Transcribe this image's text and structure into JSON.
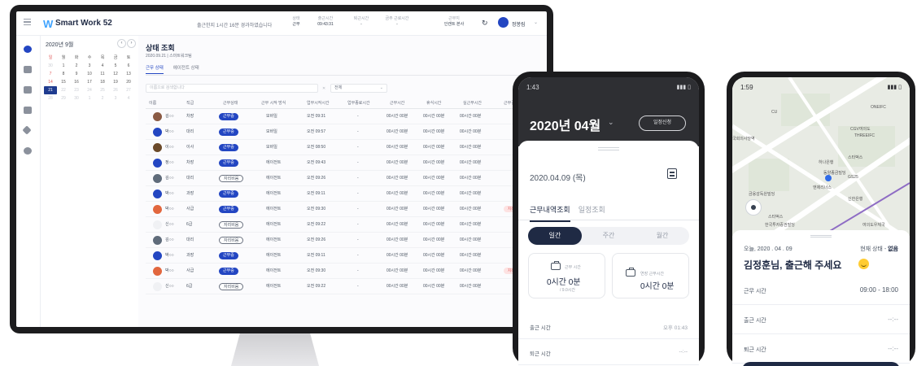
{
  "monitor": {
    "app_name": "Smart Work 52",
    "work_time_msg": "출근한지 1시간 16분 경과하였습니다",
    "header_stats": [
      {
        "label": "상태",
        "value": "근무"
      },
      {
        "label": "출근시간",
        "value": "09:43:31"
      },
      {
        "label": "퇴근시간",
        "value": "-"
      },
      {
        "label": "금주 근로시간",
        "value": "-"
      },
      {
        "label": "근무지",
        "value": "인캔트 본사"
      }
    ],
    "user_name": "정봉림",
    "calendar": {
      "title": "2020년 9월",
      "weekdays": [
        "일",
        "월",
        "화",
        "수",
        "목",
        "금",
        "토"
      ],
      "weeks": [
        [
          "30",
          "1",
          "2",
          "3",
          "4",
          "5",
          "6"
        ],
        [
          "7",
          "8",
          "9",
          "10",
          "11",
          "12",
          "13"
        ],
        [
          "14",
          "15",
          "16",
          "17",
          "18",
          "19",
          "20"
        ],
        [
          "21",
          "22",
          "23",
          "24",
          "25",
          "26",
          "27"
        ],
        [
          "28",
          "29",
          "30",
          "1",
          "2",
          "3",
          "4"
        ]
      ],
      "selected": "21"
    },
    "page_title": "상태 조회",
    "page_sub": "2020.09.21 | 스마트워크팀",
    "tabs": [
      "근무 상태",
      "에이전트 상태"
    ],
    "search_placeholder": "이름으로 검색합니다",
    "filter_value": "전체",
    "columns": [
      "이름",
      "직급",
      "근무상태",
      "근무 시작 방식",
      "업무시작시간",
      "업무종료시간",
      "근무시간",
      "휴식시간",
      "실근무시간",
      "근무결과"
    ],
    "rows": [
      {
        "name": "김○○",
        "rank": "차장",
        "status": "근무중",
        "method": "모바일",
        "start": "오전 09:31",
        "end": "-",
        "work": "00시간 00분",
        "rest": "00시간 00분",
        "real": "00시간 00분",
        "result": ""
      },
      {
        "name": "박○○",
        "rank": "대리",
        "status": "근무중",
        "method": "모바일",
        "start": "오전 09:57",
        "end": "-",
        "work": "00시간 00분",
        "rest": "00시간 00분",
        "real": "00시간 00분",
        "result": ""
      },
      {
        "name": "이○○",
        "rank": "이사",
        "status": "근무중",
        "method": "모바일",
        "start": "오전 08:50",
        "end": "-",
        "work": "00시간 00분",
        "rest": "00시간 00분",
        "real": "00시간 00분",
        "result": ""
      },
      {
        "name": "정○○",
        "rank": "차장",
        "status": "근무중",
        "method": "에이전트",
        "start": "오전 09:43",
        "end": "-",
        "work": "00시간 00분",
        "rest": "00시간 00분",
        "real": "00시간 00분",
        "result": ""
      },
      {
        "name": "김○○",
        "rank": "대리",
        "status": "자리비움",
        "method": "에이전트",
        "start": "오전 09:26",
        "end": "-",
        "work": "00시간 00분",
        "rest": "00시간 00분",
        "real": "00시간 00분",
        "result": ""
      },
      {
        "name": "박○○",
        "rank": "과장",
        "status": "근무중",
        "method": "에이전트",
        "start": "오전 09:11",
        "end": "-",
        "work": "00시간 00분",
        "rest": "00시간 00분",
        "real": "00시간 00분",
        "result": ""
      },
      {
        "name": "박○○",
        "rank": "사급",
        "status": "근무중",
        "method": "에이전트",
        "start": "오전 09:30",
        "end": "-",
        "work": "00시간 00분",
        "rest": "00시간 00분",
        "real": "00시간 00분",
        "result": "지각"
      },
      {
        "name": "신○○",
        "rank": "6급",
        "status": "자리비움",
        "method": "에이전트",
        "start": "오전 09:22",
        "end": "-",
        "work": "00시간 00분",
        "rest": "00시간 00분",
        "real": "00시간 00분",
        "result": ""
      },
      {
        "name": "김○○",
        "rank": "대리",
        "status": "자리비움",
        "method": "에이전트",
        "start": "오전 09:26",
        "end": "-",
        "work": "00시간 00분",
        "rest": "00시간 00분",
        "real": "00시간 00분",
        "result": ""
      },
      {
        "name": "박○○",
        "rank": "과장",
        "status": "근무중",
        "method": "에이전트",
        "start": "오전 09:11",
        "end": "-",
        "work": "00시간 00분",
        "rest": "00시간 00분",
        "real": "00시간 00분",
        "result": ""
      },
      {
        "name": "박○○",
        "rank": "사급",
        "status": "근무중",
        "method": "에이전트",
        "start": "오전 09:30",
        "end": "-",
        "work": "00시간 00분",
        "rest": "00시간 00분",
        "real": "00시간 00분",
        "result": "지각"
      },
      {
        "name": "신○○",
        "rank": "6급",
        "status": "자리비움",
        "method": "에이전트",
        "start": "오전 09:22",
        "end": "-",
        "work": "00시간 00분",
        "rest": "00시간 00분",
        "real": "00시간 00분",
        "result": ""
      }
    ]
  },
  "phone1": {
    "time": "1:43",
    "month": "2020년 04월",
    "apply_button": "일정신청",
    "date": "2020.04.09 (목)",
    "tabs": [
      "근무내역조회",
      "일정조회"
    ],
    "segments": [
      "일간",
      "주간",
      "월간"
    ],
    "card1": {
      "label": "근무 시간",
      "value": "0시간 0분",
      "sub": "/ 9.0시간"
    },
    "card2": {
      "label": "연장 근무시간",
      "value": "0시간 0분"
    },
    "rows": [
      {
        "label": "출근 시간",
        "value": "오후 01:43"
      },
      {
        "label": "퇴근 시간",
        "value": "--:--"
      }
    ]
  },
  "phone2": {
    "time": "1:59",
    "map_labels": [
      "CU",
      "ONEIFC",
      "CGV여의도",
      "THREEIFC",
      "하나은행",
      "스타벅스",
      "동양종금빌딩",
      "GS25",
      "앤제리너스",
      "금융감독원빌딩",
      "신한은행",
      "스타벅스",
      "한국투자증권빌딩",
      "여의도우체국",
      "국회의사당역"
    ],
    "date": "오늘, 2020 . 04 . 09",
    "state_label": "현재 상태 - ",
    "state_value": "없음",
    "greeting": "김정훈님, 출근해 주세요",
    "rows": [
      {
        "label": "근무 시간",
        "value": "09:00 - 18:00"
      },
      {
        "label": "출근 시간",
        "value": "--:--"
      },
      {
        "label": "퇴근 시간",
        "value": "--:--"
      }
    ]
  },
  "colors": {
    "brand": "#2346c2",
    "navy": "#1f2a44",
    "late": "#e05a5a"
  }
}
